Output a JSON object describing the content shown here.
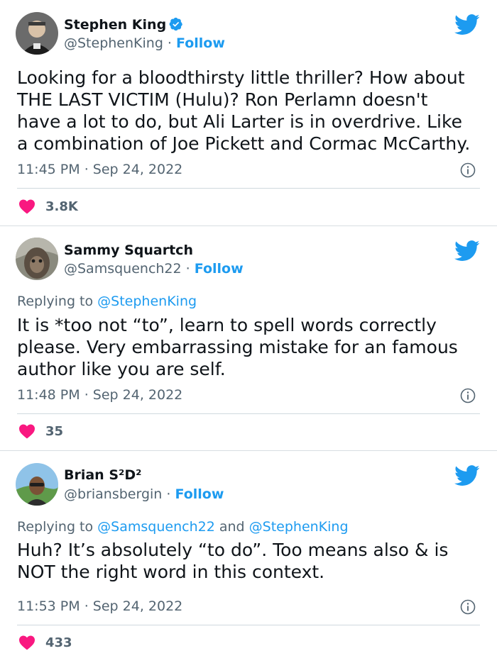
{
  "tweets": [
    {
      "author": {
        "name": "Stephen King",
        "handle": "@StephenKing",
        "verified": true,
        "follow_label": "Follow",
        "avatar_icon": "avatar-photo"
      },
      "replying_to": null,
      "text_lines": [
        "Looking for a bloodthirsty little thriller? How about",
        "THE LAST VICTIM (Hulu)? Ron Perlamn doesn't",
        "have a lot to do, but Ali Larter is in overdrive. Like",
        "a combination of Joe Pickett and Cormac McCarthy."
      ],
      "time": "11:45 PM",
      "date": "Sep 24, 2022",
      "likes": "3.8K"
    },
    {
      "author": {
        "name": "Sammy Squartch",
        "handle": "@Samsquench22",
        "verified": false,
        "follow_label": "Follow",
        "avatar_icon": "avatar-photo"
      },
      "replying_to": {
        "prefix": "Replying to",
        "mentions": [
          "@StephenKing"
        ]
      },
      "text_lines": [
        "It is *too not “to”, learn to spell words correctly",
        "please. Very embarrassing mistake for an famous",
        "author like you are self."
      ],
      "time": "11:48 PM",
      "date": "Sep 24, 2022",
      "likes": "35"
    },
    {
      "author": {
        "name": "Brian S²D²",
        "handle": "@briansbergin",
        "verified": false,
        "follow_label": "Follow",
        "avatar_icon": "avatar-photo"
      },
      "replying_to": {
        "prefix": "Replying to",
        "mentions": [
          "@Samsquench22",
          "@StephenKing"
        ],
        "joiner": "and"
      },
      "text_lines": [
        "Huh?  It’s absolutely “to do”. Too means also & is",
        "NOT the right word in this context."
      ],
      "time": "11:53 PM",
      "date": "Sep 24, 2022",
      "likes": "433"
    }
  ],
  "separator_dot": "·",
  "colors": {
    "accent": "#1d9bf0",
    "heart": "#f91880",
    "muted": "#536471",
    "text": "#0f1419"
  },
  "icons": {
    "brand": "twitter-bird-icon",
    "like": "heart-icon",
    "info": "info-icon",
    "verified": "verified-badge-icon"
  }
}
